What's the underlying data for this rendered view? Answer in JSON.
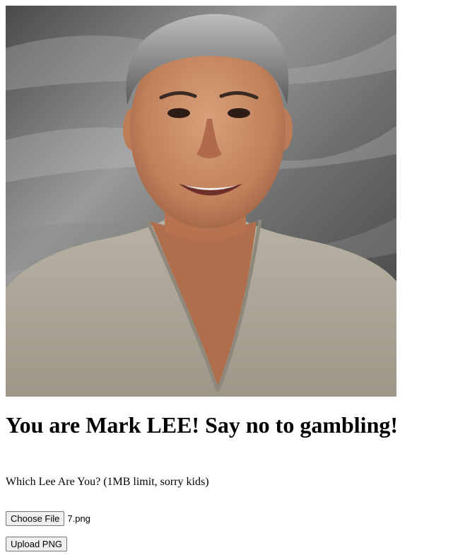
{
  "result": {
    "heading": "You are Mark LEE! Say no to gambling!",
    "photo_alt": "Mark LEE"
  },
  "form": {
    "prompt": "Which Lee Are You? (1MB limit, sorry kids)",
    "choose_file_label": "Choose File",
    "selected_file_name": "7.png",
    "upload_label": "Upload PNG"
  }
}
